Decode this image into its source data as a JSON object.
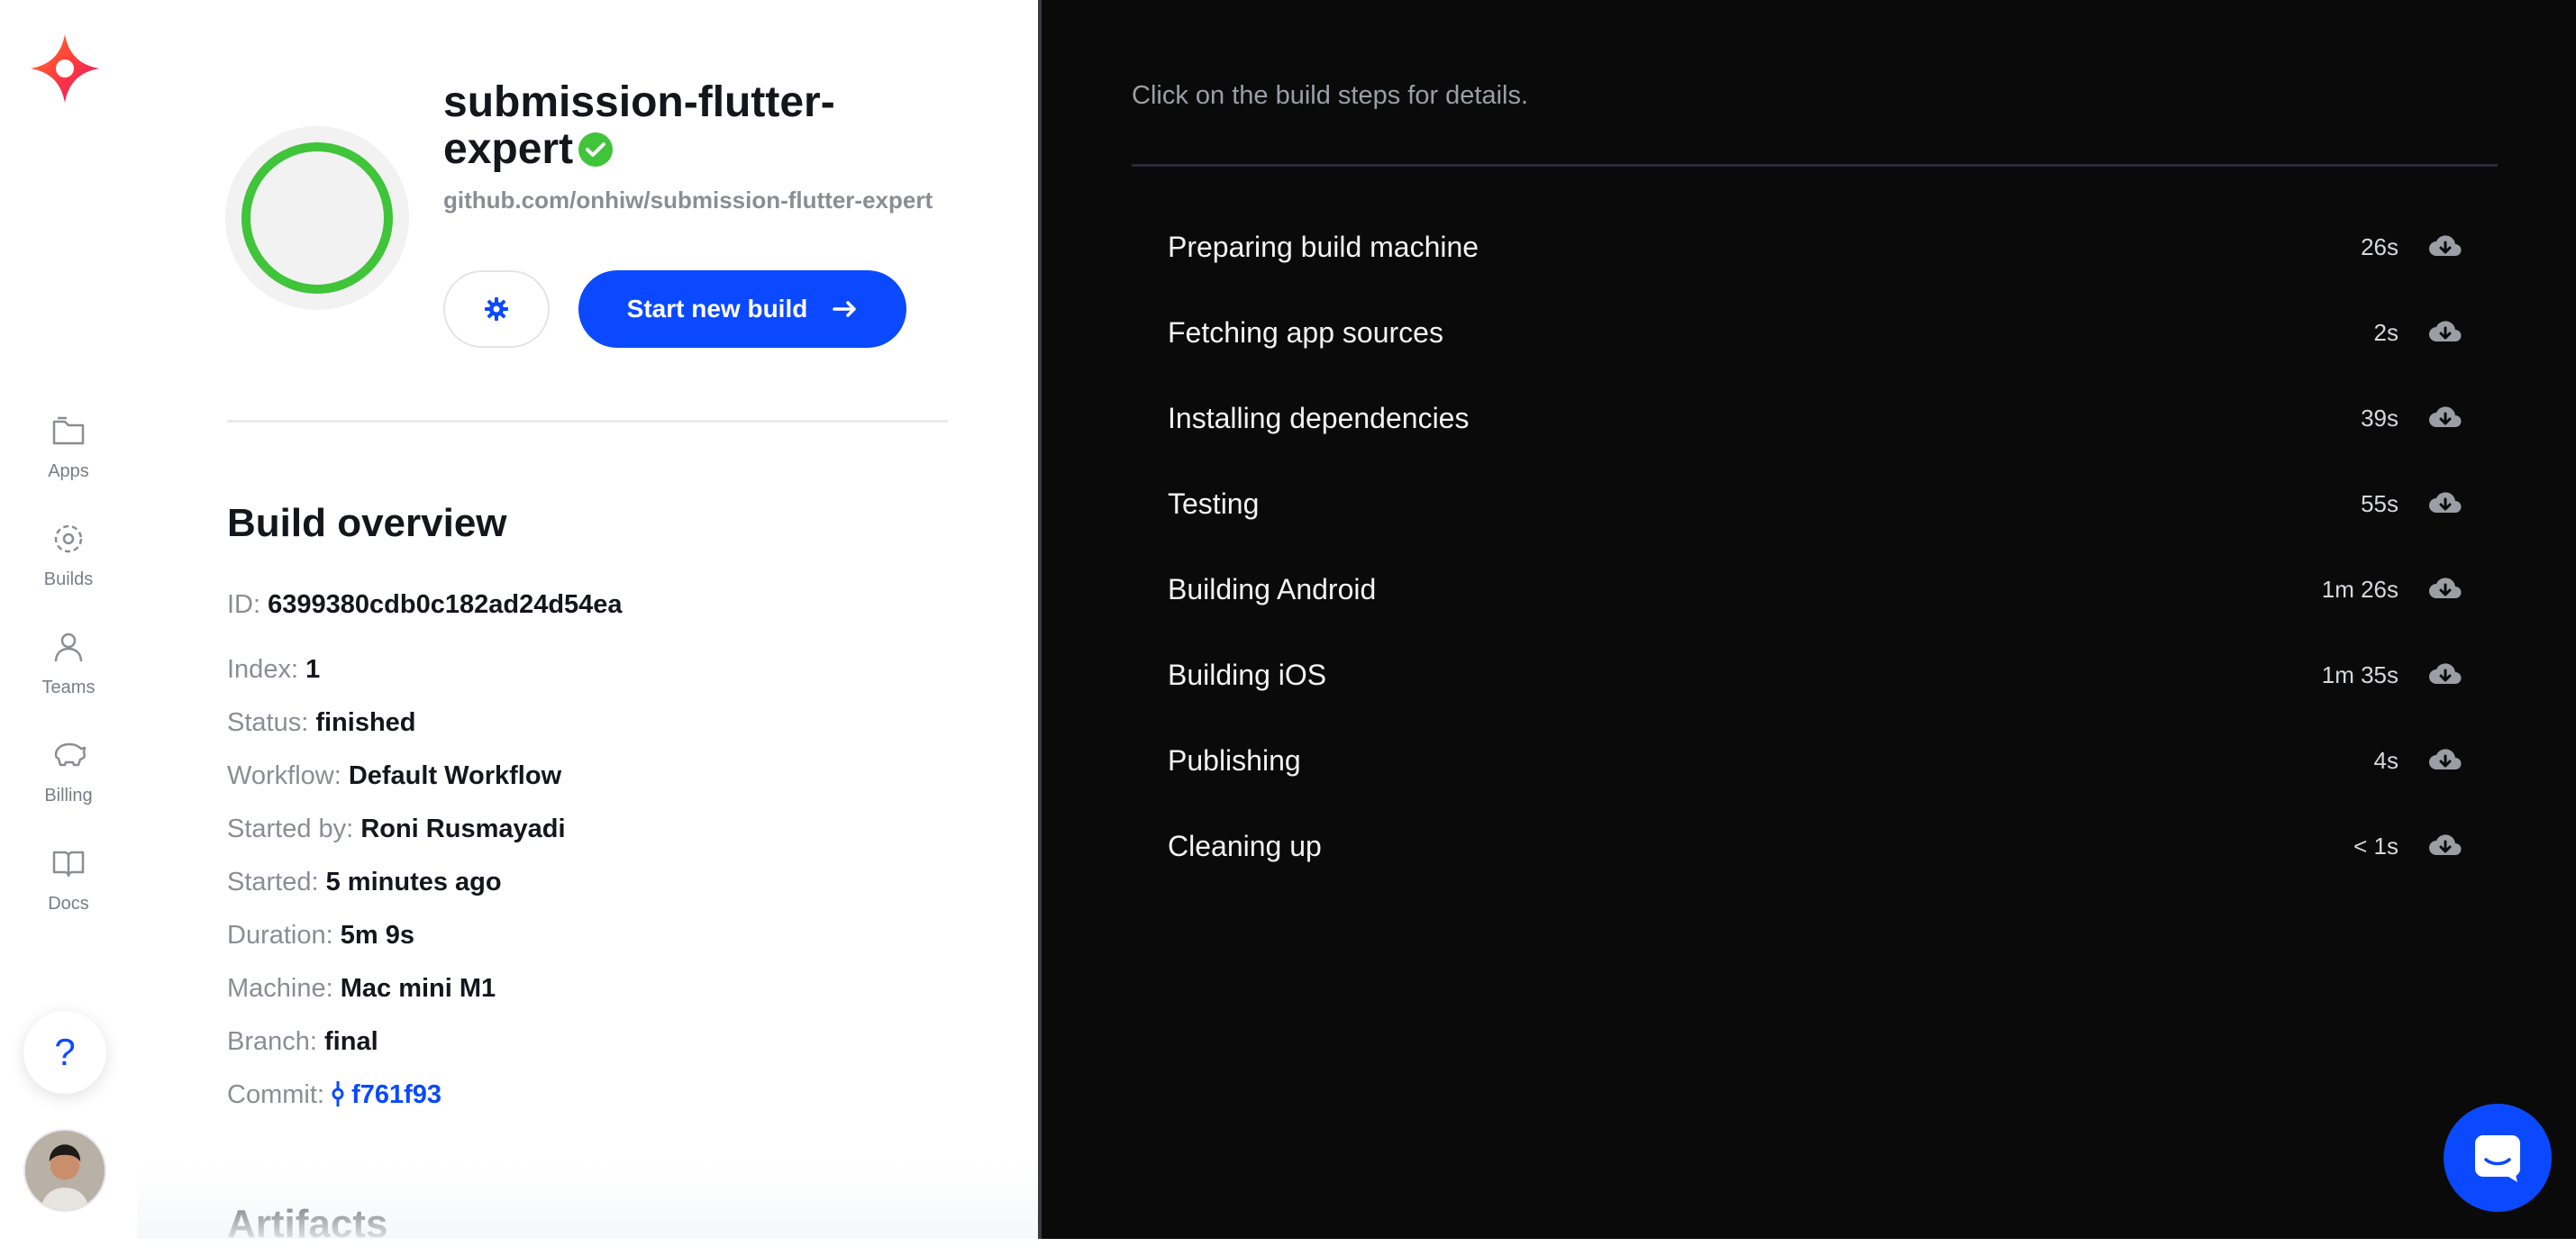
{
  "colors": {
    "accent": "#0a49ff",
    "success": "#3fc43a",
    "log_bg": "#0a0a0a"
  },
  "sidebar": {
    "items": [
      {
        "label": "Apps",
        "icon": "folder-icon"
      },
      {
        "label": "Builds",
        "icon": "builds-icon"
      },
      {
        "label": "Teams",
        "icon": "user-icon"
      },
      {
        "label": "Billing",
        "icon": "piggy-bank-icon"
      },
      {
        "label": "Docs",
        "icon": "book-icon"
      }
    ],
    "help_label": "?"
  },
  "app": {
    "title": "submission-flutter-expert",
    "repo": "github.com/onhiw/submission-flutter-expert",
    "start_build_label": "Start new build"
  },
  "overview": {
    "title": "Build overview",
    "rows": [
      {
        "key": "ID:",
        "value": "6399380cdb0c182ad24d54ea"
      },
      {
        "key": "Index:",
        "value": "1"
      },
      {
        "key": "Status:",
        "value": "finished"
      },
      {
        "key": "Workflow:",
        "value": "Default Workflow"
      },
      {
        "key": "Started by:",
        "value": "Roni Rusmayadi"
      },
      {
        "key": "Started:",
        "value": "5 minutes ago"
      },
      {
        "key": "Duration:",
        "value": "5m 9s"
      },
      {
        "key": "Machine:",
        "value": "Mac mini M1"
      },
      {
        "key": "Branch:",
        "value": "final"
      }
    ],
    "commit_key": "Commit:",
    "commit_value": "f761f93"
  },
  "artifacts_title": "Artifacts",
  "log": {
    "hint": "Click on the build steps for details.",
    "steps": [
      {
        "name": "Preparing build machine",
        "duration": "26s"
      },
      {
        "name": "Fetching app sources",
        "duration": "2s"
      },
      {
        "name": "Installing dependencies",
        "duration": "39s"
      },
      {
        "name": "Testing",
        "duration": "55s"
      },
      {
        "name": "Building Android",
        "duration": "1m 26s"
      },
      {
        "name": "Building iOS",
        "duration": "1m 35s"
      },
      {
        "name": "Publishing",
        "duration": "4s"
      },
      {
        "name": "Cleaning up",
        "duration": "< 1s"
      }
    ]
  }
}
